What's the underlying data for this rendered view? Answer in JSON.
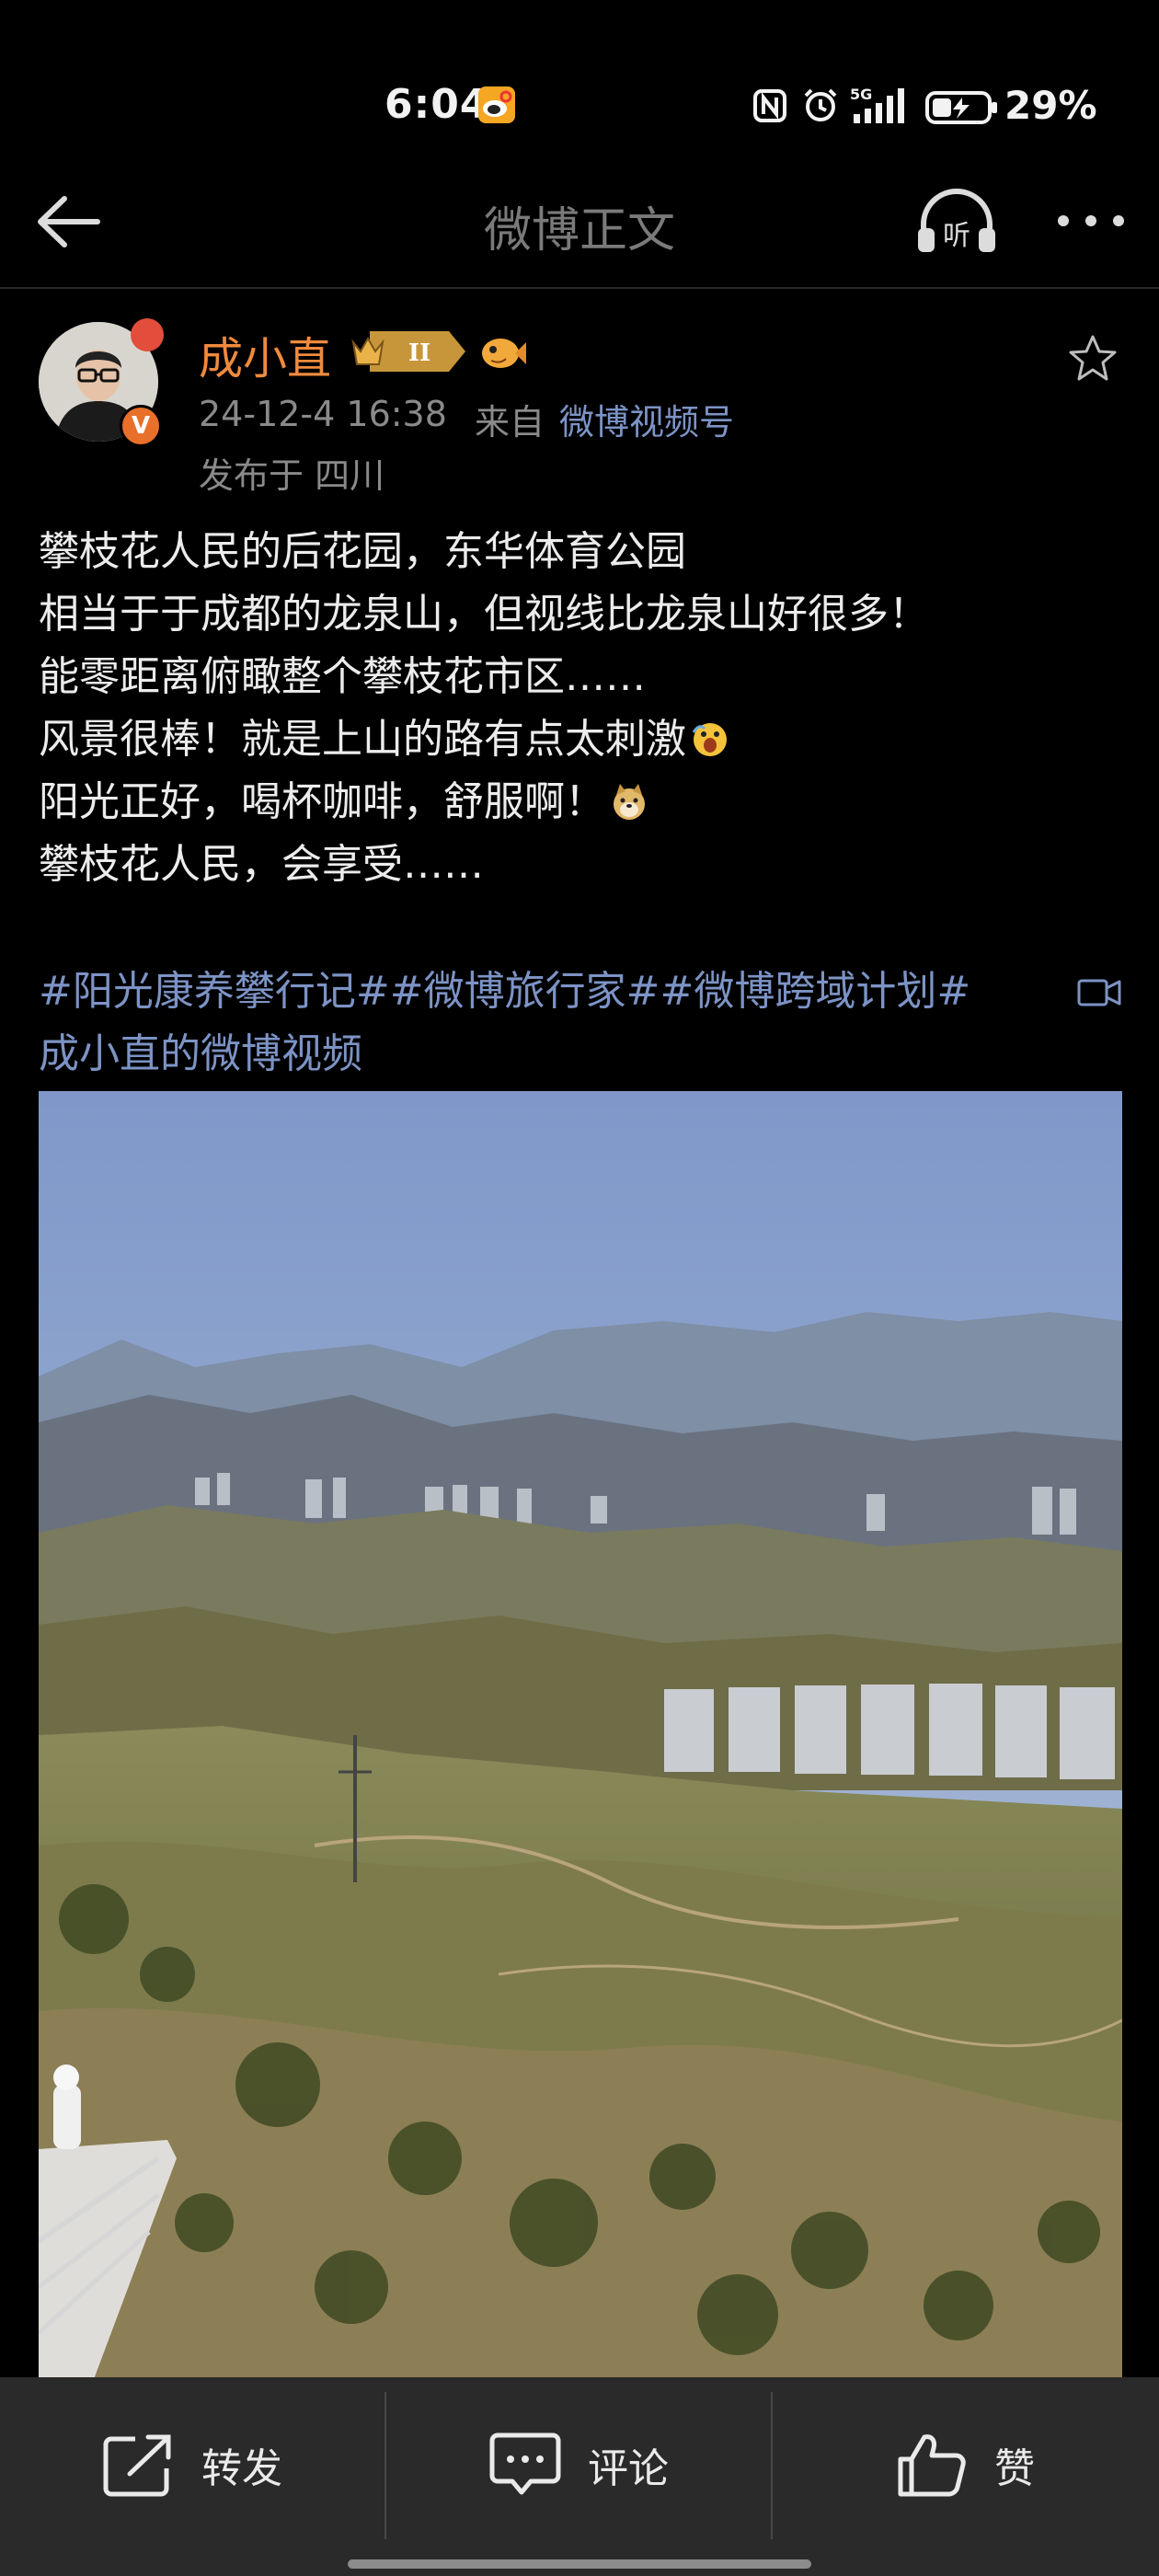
{
  "status_bar": {
    "time": "6:04",
    "signal": "5G",
    "battery": "29%"
  },
  "header": {
    "title": "微博正文",
    "listen_label": "听"
  },
  "author": {
    "name": "成小直",
    "member_level": "II",
    "verified_mark": "V",
    "post_time": "24-12-4 16:38",
    "source_prefix": "来自",
    "source": "微博视频号",
    "location": "发布于 四川"
  },
  "post": {
    "lines": [
      "攀枝花人民的后花园，东华体育公园",
      "相当于于成都的龙泉山，但视线比龙泉山好很多！",
      "能零距离俯瞰整个攀枝花市区……",
      "风景很棒！就是上山的路有点太刺激",
      "阳光正好，喝杯咖啡，舒服啊！",
      "攀枝花人民，会享受……"
    ],
    "tags": [
      "#阳光康养攀行记#",
      "#微博旅行家#",
      "#微博跨域计划#"
    ],
    "video_link": "成小直的微博视频"
  },
  "actions": {
    "repost": "转发",
    "comment": "评论",
    "like": "赞"
  },
  "colors": {
    "background": "#000000",
    "author_name": "#f08a3c",
    "link": "#7c93c5",
    "muted": "#8a8a8a",
    "bottom_bar": "#2a2a2a"
  },
  "icons": [
    "back-arrow-icon",
    "headphones-icon",
    "more-icon",
    "star-icon",
    "video-camera-icon",
    "repost-icon",
    "comment-icon",
    "thumbs-up-icon"
  ]
}
